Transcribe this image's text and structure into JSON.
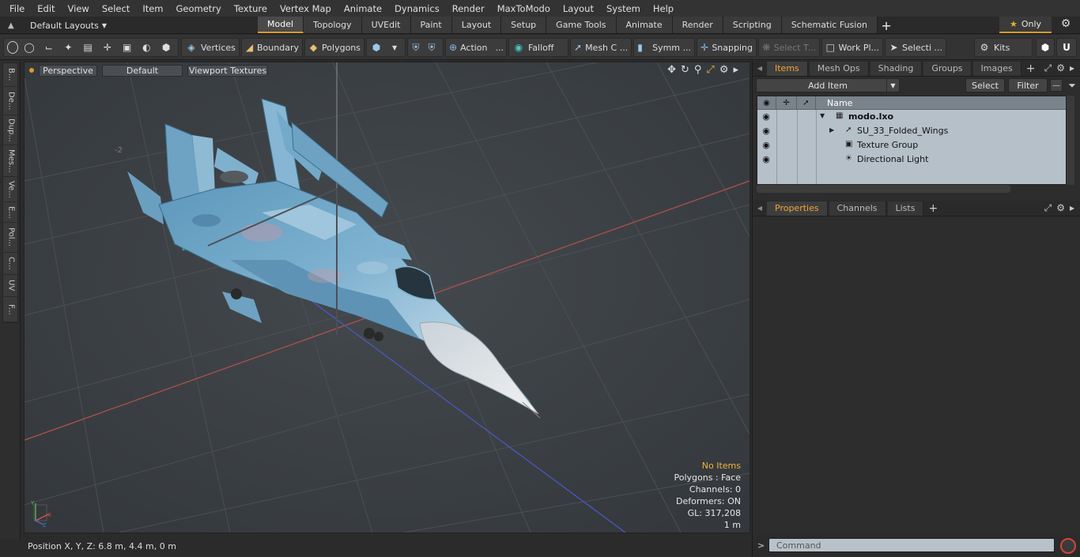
{
  "menu": [
    "File",
    "Edit",
    "View",
    "Select",
    "Item",
    "Geometry",
    "Texture",
    "Vertex Map",
    "Animate",
    "Dynamics",
    "Render",
    "MaxToModo",
    "Layout",
    "System",
    "Help"
  ],
  "layout_dropdown": "Default Layouts",
  "layout_tabs": [
    {
      "label": "Model",
      "active": true
    },
    {
      "label": "Topology",
      "active": false
    },
    {
      "label": "UVEdit",
      "active": false
    },
    {
      "label": "Paint",
      "active": false
    },
    {
      "label": "Layout",
      "active": false
    },
    {
      "label": "Setup",
      "active": false
    },
    {
      "label": "Game Tools",
      "active": false
    },
    {
      "label": "Animate",
      "active": false
    },
    {
      "label": "Render",
      "active": false
    },
    {
      "label": "Scripting",
      "active": false
    },
    {
      "label": "Schematic Fusion",
      "active": false
    }
  ],
  "only_label": "Only",
  "toolbar": {
    "vertices": "Vertices",
    "boundary": "Boundary",
    "polygons": "Polygons",
    "action": "Action",
    "action_more": "...",
    "falloff": "Falloff",
    "mesh_c": "Mesh C ...",
    "symm": "Symm ...",
    "snapping": "Snapping",
    "select_t": "Select T...",
    "work_pl": "Work Pl...",
    "selecti": "Selecti ...",
    "kits": "Kits"
  },
  "left_tabs": [
    "B...",
    "De...",
    "Dup...",
    "Mes...",
    "Ve...",
    "E...",
    "Pol...",
    "C...",
    "UV",
    "F..."
  ],
  "viewport": {
    "projection": "Perspective",
    "style": "Default",
    "shading": "Viewport Textures",
    "grid_label": "-2",
    "info": {
      "no_items": "No Items",
      "polygons": "Polygons : Face",
      "channels": "Channels: 0",
      "deformers": "Deformers: ON",
      "gl": "GL: 317,208",
      "scale": "1 m"
    },
    "axis": {
      "x": "X",
      "y": "Y",
      "z": "Z"
    }
  },
  "status": {
    "position": "Position X, Y, Z:  6.8 m, 4.4 m, 0 m"
  },
  "items_panel": {
    "tabs": [
      {
        "label": "Items",
        "active": true
      },
      {
        "label": "Mesh Ops",
        "active": false
      },
      {
        "label": "Shading",
        "active": false
      },
      {
        "label": "Groups",
        "active": false
      },
      {
        "label": "Images",
        "active": false
      }
    ],
    "add_item": "Add Item",
    "select": "Select",
    "filter": "Filter",
    "name_header": "Name",
    "rows": [
      {
        "label": "modo.lxo"
      },
      {
        "label": "SU_33_Folded_Wings"
      },
      {
        "label": "Texture Group"
      },
      {
        "label": "Directional Light"
      }
    ]
  },
  "properties_panel": {
    "tabs": [
      {
        "label": "Properties",
        "active": true
      },
      {
        "label": "Channels",
        "active": false
      },
      {
        "label": "Lists",
        "active": false
      }
    ]
  },
  "command": {
    "prompt": ">",
    "placeholder": "Command"
  },
  "colors": {
    "accent": "#d99a2b",
    "jet_camo": "#6fa6c6",
    "item_list_bg": "#b6c0c9"
  }
}
